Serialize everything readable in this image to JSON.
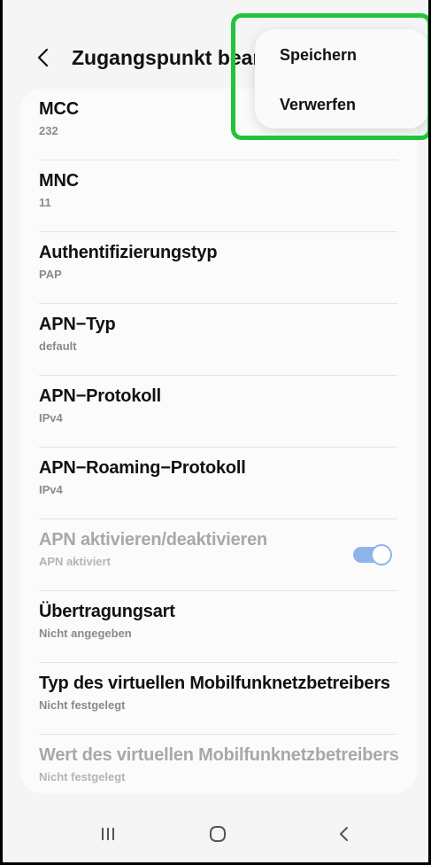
{
  "header": {
    "title": "Zugangspunkt bearbeiten",
    "back_icon": "chevron-left-icon"
  },
  "menu": {
    "items": [
      {
        "label": "Speichern"
      },
      {
        "label": "Verwerfen"
      }
    ]
  },
  "settings": {
    "items": [
      {
        "title": "MCC",
        "value": "232",
        "enabled": true
      },
      {
        "title": "MNC",
        "value": "11",
        "enabled": true
      },
      {
        "title": "Authentifizierungstyp",
        "value": "PAP",
        "enabled": true
      },
      {
        "title": "APN−Typ",
        "value": "default",
        "enabled": true
      },
      {
        "title": "APN−Protokoll",
        "value": "IPv4",
        "enabled": true
      },
      {
        "title": "APN−Roaming−Protokoll",
        "value": "IPv4",
        "enabled": true
      },
      {
        "title": "APN aktivieren/deaktivieren",
        "value": "APN aktiviert",
        "enabled": false,
        "toggle_on": true
      },
      {
        "title": "Übertragungsart",
        "value": "Nicht angegeben",
        "enabled": true
      },
      {
        "title": "Typ des virtuellen Mobilfunknetzbetreibers",
        "value": "Nicht festgelegt",
        "enabled": true
      },
      {
        "title": "Wert des virtuellen Mobilfunknetzbetreibers",
        "value": "Nicht festgelegt",
        "enabled": false
      }
    ]
  },
  "navbar": {
    "recents_icon": "recent-apps-icon",
    "home_icon": "home-icon",
    "back_icon": "back-icon"
  },
  "colors": {
    "highlight": "#22c33a",
    "toggle": "#8fb4ea",
    "background": "#f5f5f5",
    "card": "#fbfbfb"
  }
}
